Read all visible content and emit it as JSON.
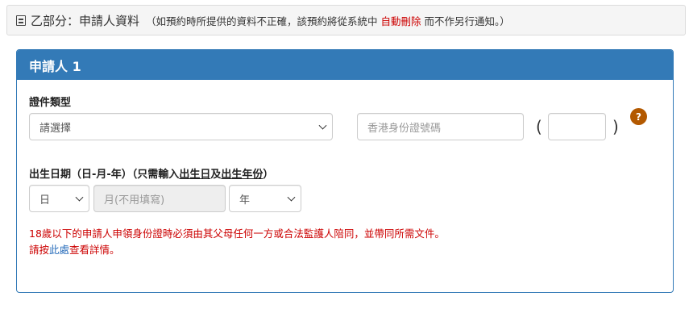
{
  "section": {
    "title": "乙部分：申請人資料",
    "note_prefix": "（如預約時所提供的資料不正確，該預約將從系統中",
    "note_highlight": "自動刪除",
    "note_suffix": "而不作另行通知。）"
  },
  "applicant": {
    "heading": "申請人 1",
    "id_type": {
      "label": "證件類型",
      "selected": "請選擇"
    },
    "hkid": {
      "placeholder": "香港身份證號碼",
      "check_digit": "",
      "open_paren": "(",
      "close_paren": ")"
    },
    "help_icon": "question-mark-icon",
    "help_glyph": "?",
    "dob": {
      "label_main": "出生日期（日-月-年）",
      "label_hint_1": "（只需輸入",
      "label_hint_u1": "出生日",
      "label_hint_2": "及",
      "label_hint_u2": "出生年份",
      "label_hint_3": "）",
      "day_selected": "日",
      "month_placeholder": "月(不用填寫)",
      "year_selected": "年"
    },
    "notice": {
      "line1": "18歲以下的申請人申領身份證時必須由其父母任何一方或合法監護人陪同，並帶同所需文件。",
      "line2_prefix": "請按",
      "line2_link": "此處",
      "line2_suffix": "查看詳情。"
    }
  },
  "colors": {
    "panel_header": "#337ab7",
    "warning_text": "#cc0000",
    "link": "#2a6ebb",
    "help_icon_bg": "#b35900"
  }
}
